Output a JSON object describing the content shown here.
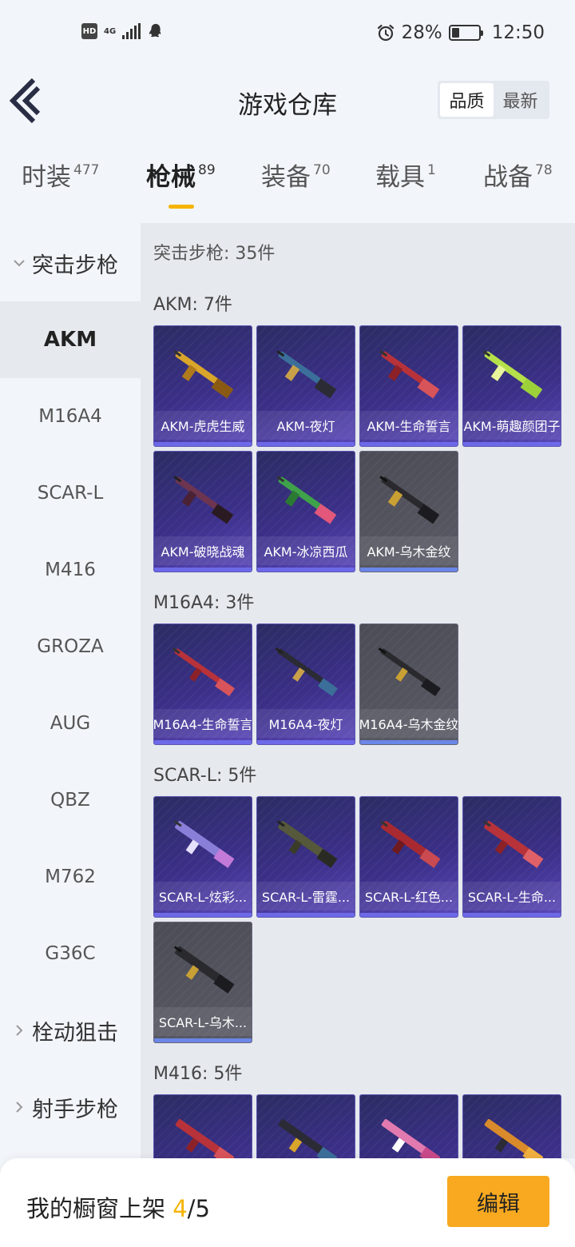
{
  "status_bar": {
    "hd": "HD",
    "network": "4G",
    "battery_pct": "28%",
    "battery_level": 0.28,
    "time": "12:50"
  },
  "header": {
    "title": "游戏仓库",
    "sort": [
      "品质",
      "最新"
    ],
    "sort_active": 0
  },
  "tabs": [
    {
      "label": "时装",
      "count": "477"
    },
    {
      "label": "枪械",
      "count": "89",
      "active": true
    },
    {
      "label": "装备",
      "count": "70"
    },
    {
      "label": "载具",
      "count": "1"
    },
    {
      "label": "战备",
      "count": "78"
    }
  ],
  "sidebar": {
    "expanded_category": "突击步枪",
    "items": [
      "AKM",
      "M16A4",
      "SCAR-L",
      "M416",
      "GROZA",
      "AUG",
      "QBZ",
      "M762",
      "G36C"
    ],
    "active_item": "AKM",
    "collapsed_categories": [
      "栓动狙击",
      "射手步枪"
    ]
  },
  "main": {
    "total": "突击步枪: 35件",
    "groups": [
      {
        "label": "AKM: 7件",
        "items": [
          "AKM-虎虎生威",
          "AKM-夜灯",
          "AKM-生命誓言",
          "AKM-萌趣颜团子",
          "AKM-破晓战魂",
          "AKM-冰凉西瓜",
          "AKM-乌木金纹"
        ]
      },
      {
        "label": "M16A4: 3件",
        "items": [
          "M16A4-生命誓言",
          "M16A4-夜灯",
          "M16A4-乌木金纹"
        ]
      },
      {
        "label": "SCAR-L: 5件",
        "items": [
          "SCAR-L-炫彩...",
          "SCAR-L-雷霆...",
          "SCAR-L-红色...",
          "SCAR-L-生命...",
          "SCAR-L-乌木..."
        ]
      },
      {
        "label": "M416: 5件",
        "items": [
          "",
          "",
          "",
          ""
        ]
      }
    ]
  },
  "bottom": {
    "showcase_label": "我的橱窗上架 ",
    "showcase_current": "4",
    "showcase_total": "/5",
    "edit_label": "编辑"
  },
  "colors": {
    "accent": "#f5b400",
    "button": "#f8a920",
    "card_purple": "#3b2f88",
    "card_grey": "#5a5a66"
  }
}
